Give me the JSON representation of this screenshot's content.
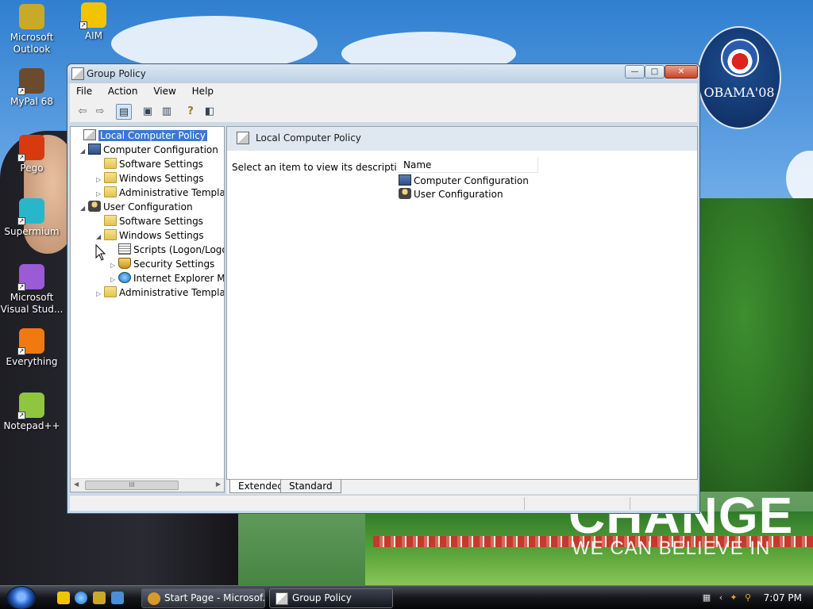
{
  "desktop": {
    "icons": [
      {
        "label": "Microsoft Outlook",
        "line1": "Microsoft",
        "line2": "Outlook",
        "color": "#c9a928"
      },
      {
        "label": "AIM",
        "line1": "AIM",
        "line2": "",
        "color": "#f2c400"
      },
      {
        "label": "MyPal 68",
        "line1": "MyPal 68",
        "line2": "",
        "color": "#6b4a2e"
      },
      {
        "label": "Pego",
        "line1": "Pego",
        "line2": "",
        "color": "#d83a10"
      },
      {
        "label": "Supermium",
        "line1": "Supermium",
        "line2": "",
        "color": "#28b7c9"
      },
      {
        "label": "Microsoft Visual Stud...",
        "line1": "Microsoft",
        "line2": "Visual Stud...",
        "color": "#9b5ad6"
      },
      {
        "label": "Everything",
        "line1": "Everything",
        "line2": "",
        "color": "#f07a10"
      },
      {
        "label": "Notepad++",
        "line1": "Notepad++",
        "line2": "",
        "color": "#8ec63f"
      }
    ],
    "wallpaper": {
      "badge_text": "OBAMA'08",
      "slogan_main": "CHANGE",
      "slogan_sub": "WE CAN BELIEVE IN"
    }
  },
  "window": {
    "title": "Group Policy",
    "buttons": {
      "minimize": "—",
      "maximize": "□",
      "close": "✕"
    },
    "menu": [
      "File",
      "Action",
      "View",
      "Help"
    ],
    "toolbar": [
      {
        "name": "back-icon",
        "glyph": "⇦"
      },
      {
        "name": "forward-icon",
        "glyph": "⇨"
      },
      {
        "name": "show-hide-tree-icon",
        "glyph": "▤"
      },
      {
        "name": "properties-icon",
        "glyph": "▣"
      },
      {
        "name": "export-list-icon",
        "glyph": "▥"
      },
      {
        "name": "help-icon",
        "glyph": "?"
      },
      {
        "name": "show-hide-action-pane-icon",
        "glyph": "◧"
      }
    ],
    "tree": [
      {
        "label": "Local Computer Policy",
        "level": 0,
        "expander": "",
        "icon": "policy-ic",
        "selected": true
      },
      {
        "label": "Computer Configuration",
        "level": 1,
        "expander": "◢",
        "icon": "computer-ic",
        "selected": false
      },
      {
        "label": "Software Settings",
        "level": 2,
        "expander": "",
        "icon": "folder",
        "selected": false
      },
      {
        "label": "Windows Settings",
        "level": 2,
        "expander": "▷",
        "icon": "folder",
        "selected": false
      },
      {
        "label": "Administrative Templates",
        "level": 2,
        "expander": "▷",
        "icon": "folder",
        "selected": false
      },
      {
        "label": "User Configuration",
        "level": 1,
        "expander": "◢",
        "icon": "user-ic",
        "selected": false
      },
      {
        "label": "Software Settings",
        "level": 2,
        "expander": "",
        "icon": "folder",
        "selected": false
      },
      {
        "label": "Windows Settings",
        "level": 2,
        "expander": "◢",
        "icon": "folder",
        "selected": false
      },
      {
        "label": "Scripts (Logon/Logoff)",
        "level": 3,
        "expander": "",
        "icon": "script-ic",
        "selected": false
      },
      {
        "label": "Security Settings",
        "level": 3,
        "expander": "▷",
        "icon": "shield-ic",
        "selected": false
      },
      {
        "label": "Internet Explorer Maintenance",
        "level": 3,
        "expander": "▷",
        "icon": "ie-ic",
        "selected": false
      },
      {
        "label": "Administrative Templates",
        "level": 2,
        "expander": "▷",
        "icon": "folder",
        "selected": false
      }
    ],
    "scrollbar_grip": "III",
    "right_pane": {
      "header_title": "Local Computer Policy",
      "description": "Select an item to view its description.",
      "column_name": "Name",
      "items": [
        {
          "label": "Computer Configuration",
          "icon": "computer-ic"
        },
        {
          "label": "User Configuration",
          "icon": "user-ic"
        }
      ]
    },
    "tabs": [
      "Extended",
      "Standard"
    ]
  },
  "taskbar": {
    "tasks": [
      {
        "label": "Start Page - Microsof...",
        "active": false
      },
      {
        "label": "Group Policy",
        "active": true
      }
    ],
    "clock": "7:07 PM"
  }
}
